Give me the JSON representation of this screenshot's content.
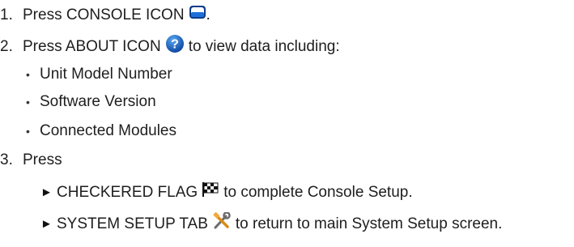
{
  "steps": [
    {
      "number": "1.",
      "text": "Press CONSOLE ICON",
      "tail": ".",
      "icon": "console-icon"
    },
    {
      "number": "2.",
      "text": "Press ABOUT ICON",
      "tail": "to view data including:",
      "icon": "about-icon",
      "bullets": [
        "Unit Model Number",
        "Software Version",
        "Connected Modules"
      ]
    },
    {
      "number": "3.",
      "text": "Press",
      "options": [
        {
          "arrow": "►",
          "text": "CHECKERED FLAG",
          "tail": "to complete Console Setup.",
          "icon": "checkered-flag-icon"
        },
        {
          "arrow": "►",
          "text": "SYSTEM SETUP TAB",
          "tail": "to return to main System Setup screen.",
          "icon": "system-setup-tools-icon"
        }
      ]
    }
  ],
  "bullet_glyph": "•",
  "colors": {
    "text": "#1e1e1e",
    "about_icon_blue": "#1565c0",
    "console_icon_blue": "#1e6fd9"
  }
}
